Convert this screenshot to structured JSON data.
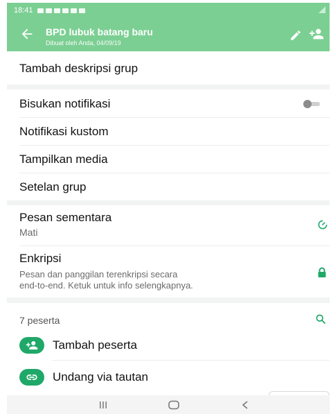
{
  "status_bar": {
    "time": "18:41",
    "icons": [
      "chat-icon",
      "image-icon",
      "check-icon",
      "image-icon",
      "image-icon",
      "image-icon"
    ]
  },
  "header": {
    "title": "BPD lubuk batang baru",
    "subtitle": "Dibuat oleh Anda, 04/09/19",
    "back_icon": "arrow-left-icon",
    "edit_icon": "pencil-icon",
    "add_icon": "person-add-icon"
  },
  "description": {
    "label": "Tambah deskripsi grup"
  },
  "settings": {
    "mute": {
      "label": "Bisukan notifikasi",
      "enabled": false
    },
    "custom": {
      "label": "Notifikasi kustom"
    },
    "media": {
      "label": "Tampilkan media"
    },
    "group": {
      "label": "Setelan grup"
    }
  },
  "disappearing": {
    "label": "Pesan sementara",
    "value": "Mati",
    "icon": "timer-icon"
  },
  "encryption": {
    "label": "Enkripsi",
    "line1": "Pesan dan panggilan terenkripsi secara",
    "line2": "end-to-end. Ketuk untuk info selengkapnya.",
    "icon": "lock-icon"
  },
  "participants": {
    "count_label": "7 peserta",
    "search_icon": "search-icon",
    "add_label": "Tambah peserta",
    "invite_label": "Undang via tautan"
  },
  "colors": {
    "brand": "#7ccf93",
    "accent": "#20a869"
  },
  "nav": {
    "recents": "recents-icon",
    "home": "home-icon",
    "back": "back-icon"
  }
}
